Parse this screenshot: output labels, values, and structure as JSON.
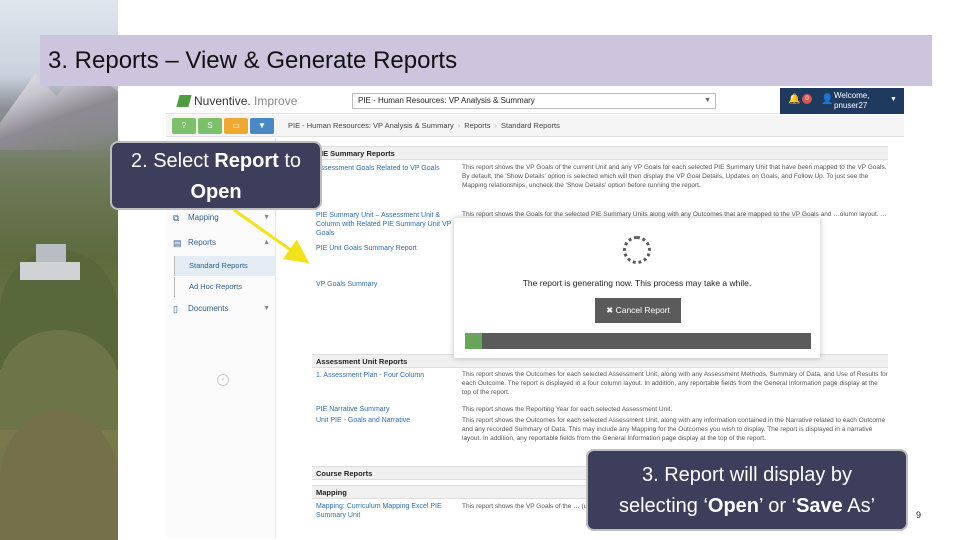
{
  "slide": {
    "title": "3. Reports – View & Generate Reports",
    "page_number": "9"
  },
  "app": {
    "logo_brand": "Nuventive.",
    "logo_product": "Improve",
    "plan_select": "PIE - Human Resources: VP Analysis & Summary",
    "notification_count": "0",
    "welcome_line1": "Welcome,",
    "welcome_line2": "pnuser27",
    "toolbar": {
      "help": "?",
      "s_button": "S"
    },
    "breadcrumb": [
      "PIE - Human Resources: VP Analysis & Summary",
      "Reports",
      "Standard Reports"
    ]
  },
  "sidebar": {
    "mapping": "Mapping",
    "reports": "Reports",
    "standard_reports": "Standard Reports",
    "ad_hoc_reports": "Ad Hoc Reports",
    "documents": "Documents"
  },
  "content": {
    "section1": "PIE Summary Reports",
    "r1_link": "Assessment Goals Related to VP Goals",
    "r1_desc": "This report shows the VP Goals of the current Unit and any VP Goals for each selected PIE Summary Unit that have been mapped to the VP Goals. By default, the 'Show Details' option is selected which will then display the VP Goal Details, Updates on Goals, and Follow Up. To just see the Mapping relationships, uncheck the 'Show Details' option before running the report.",
    "r2_link": "PIE Summary Unit – Assessment Unit & Column with Related PIE Summary Unit VP Goals",
    "r2_desc": "This report shows the Goals for the selected PIE Summary Units along with any Outcomes that are mapped to the VP Goals and …olumn layout. …ts at the report.",
    "r3_link": "PIE Unit Goals Summary Report",
    "r3_desc": "…ssessment. …Outcome and the …nd tables.",
    "r4_link": "VP Goals Summary",
    "r4_desc": "…selected for each …will appear on the …appear on the …ultiple plans, please …Filter area on the",
    "section2": "Assessment Unit Reports",
    "r5_link": "1. Assessment Plan - Four Column",
    "r5_desc": "This report shows the Outcomes for each selected Assessment Unit, along with any Assessment Methods, Summary of Data, and Use of Results for each Outcome. The report is displayed in a four column layout. In addition, any reportable fields from the General Information page display at the top of the report.",
    "r6_link": "PIE Narrative Summary",
    "r6_desc": "This report shows the Reporting Year for each selected Assessment Unit.",
    "r7_link": "Unit PIE - Goals and Narrative",
    "r7_desc": "This report shows the Outcomes for each selected Assessment Unit, along with any information contained in the Narrative related to each Outcome and any recorded Summary of Data. This may include any Mapping for the Outcomes you wish to display. The report is displayed in a narrative layout. In addition, any reportable fields from the General Information page display at the top of the report.",
    "section3": "Course Reports",
    "section4": "Mapping",
    "r8_link": "Mapping: Curriculum Mapping Excel PIE Summary Unit",
    "r8_desc": "This report shows the VP Goals of the … (user.currentUnit.type.bundle.curri…"
  },
  "modal": {
    "message": "The report is generating now. This process may take a while.",
    "cancel_label": "Cancel Report",
    "progress_fraction": 0.05
  },
  "callouts": {
    "c1_a": "2. Select ",
    "c1_b": "Report",
    "c1_c": " to",
    "c1_d": "Open",
    "c2_line1": "3. Report will display by",
    "c2_a": "selecting ‘",
    "c2_b": "Open",
    "c2_c": "’ or ‘",
    "c2_d": "Save",
    "c2_e": " As’"
  },
  "colors": {
    "title_bar": "#cdc4de",
    "callout_bg": "#3d3d5c",
    "arrow": "#f2e21a",
    "header_dark": "#1f3a5f",
    "progress_fill": "#6aa35a"
  }
}
